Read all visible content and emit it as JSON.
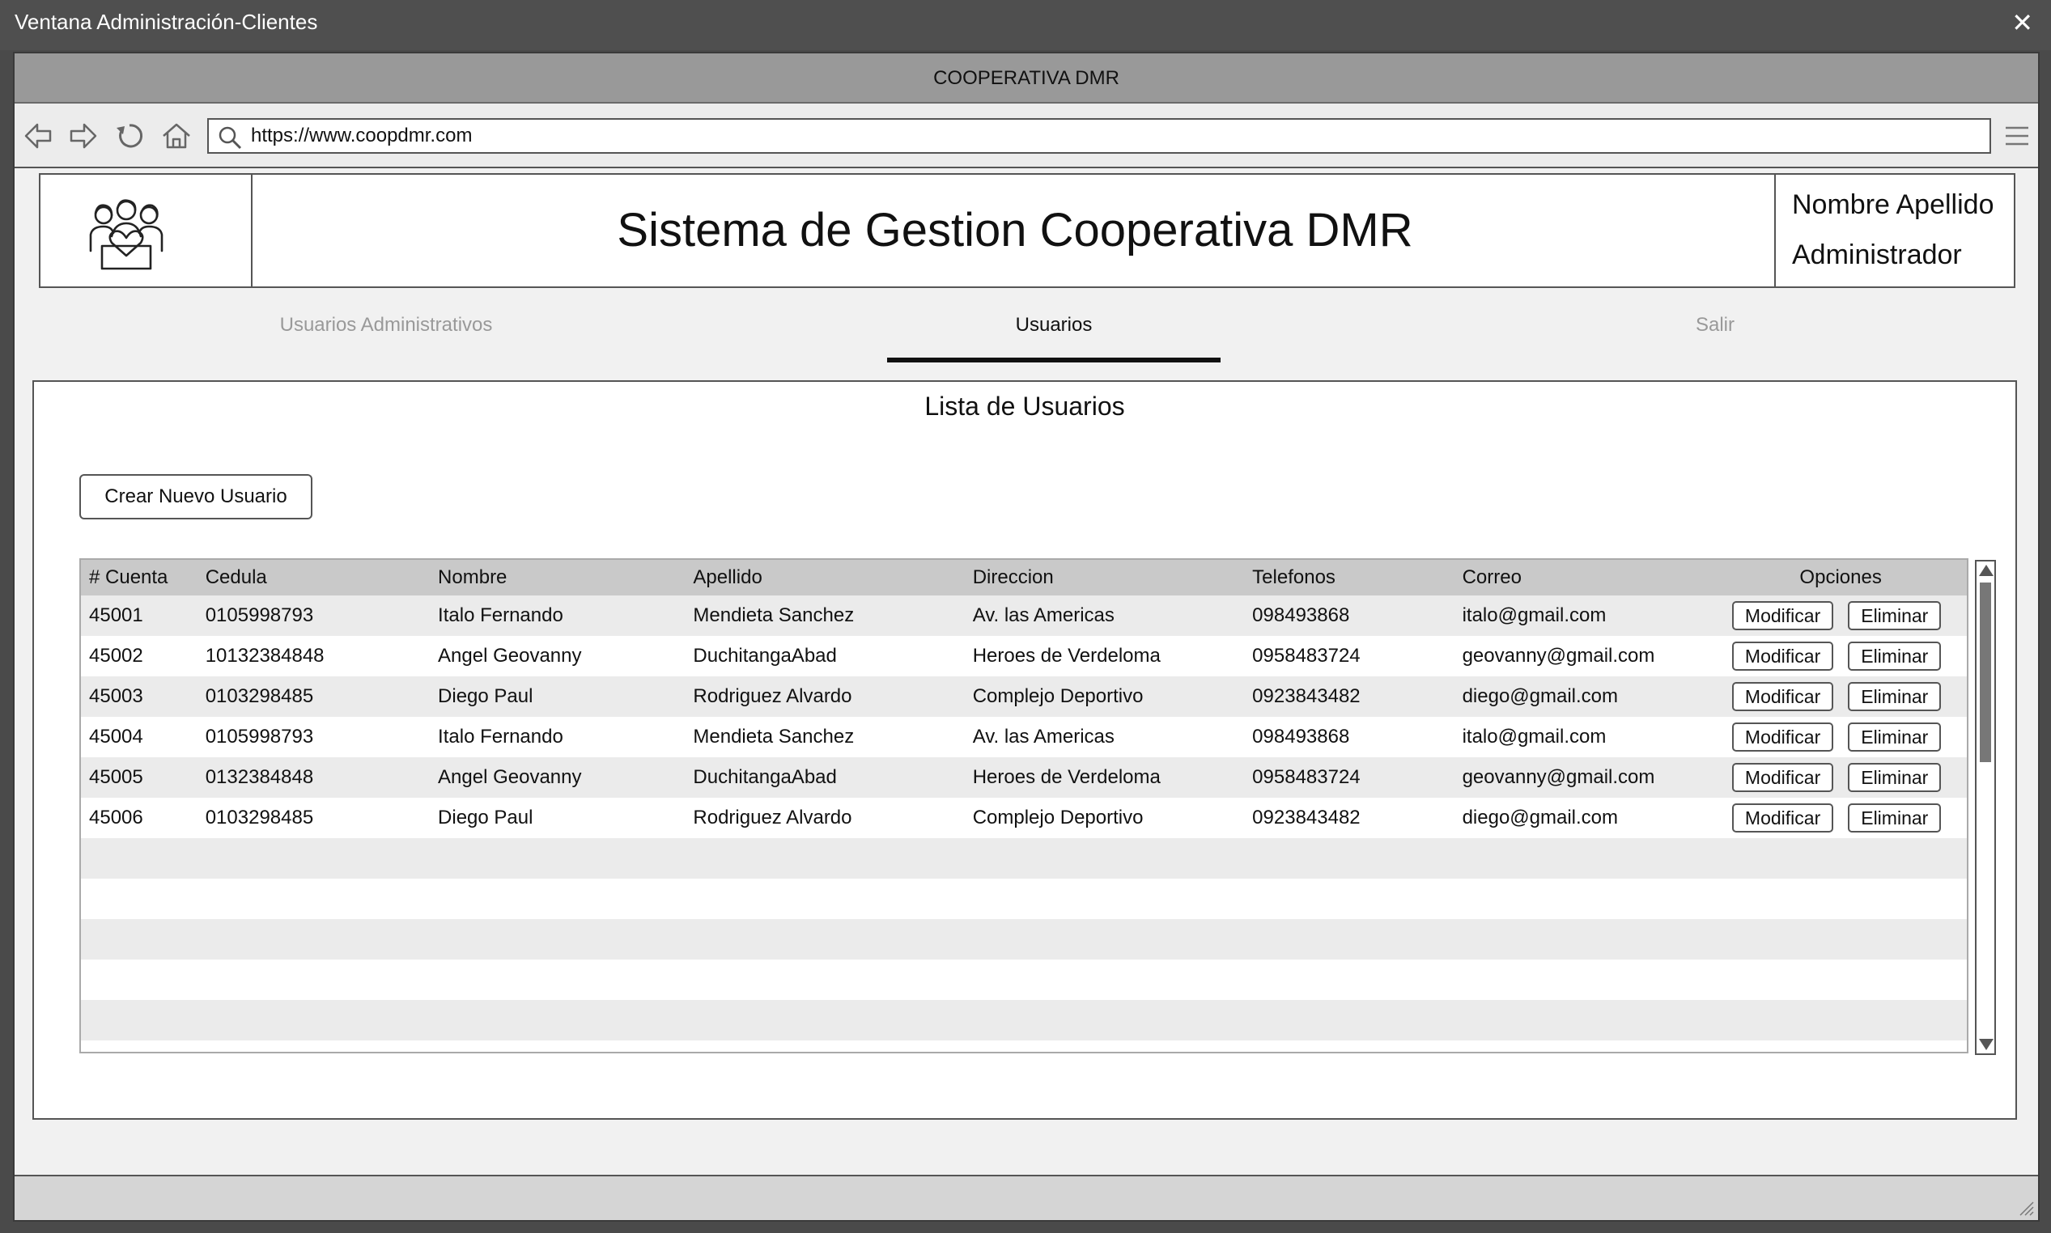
{
  "os_window": {
    "title": "Ventana Administración-Clientes",
    "close_glyph": "✕"
  },
  "browser": {
    "page_title": "COOPERATIVA DMR",
    "url": "https://www.coopdmr.com"
  },
  "header": {
    "title": "Sistema de Gestion Cooperativa DMR",
    "user_name": "Nombre Apellido",
    "user_role": "Administrador",
    "logo_icon": "family-heart-icon"
  },
  "tabs": [
    {
      "label": "Usuarios Administrativos",
      "active": false
    },
    {
      "label": "Usuarios",
      "active": true
    },
    {
      "label": "Salir",
      "active": false
    }
  ],
  "panel": {
    "title": "Lista de Usuarios",
    "create_button": "Crear Nuevo Usuario"
  },
  "table": {
    "columns": [
      "# Cuenta",
      "Cedula",
      "Nombre",
      "Apellido",
      "Direccion",
      "Telefonos",
      "Correo",
      "Opciones"
    ],
    "modify_label": "Modificar",
    "delete_label": "Eliminar",
    "rows": [
      [
        "45001",
        "0105998793",
        "Italo Fernando",
        "Mendieta Sanchez",
        "Av. las Americas",
        "098493868",
        "italo@gmail.com"
      ],
      [
        "45002",
        "10132384848",
        "Angel Geovanny",
        "DuchitangaAbad",
        "Heroes de Verdeloma",
        "0958483724",
        "geovanny@gmail.com"
      ],
      [
        "45003",
        "0103298485",
        "Diego Paul",
        "Rodriguez Alvardo",
        "Complejo Deportivo",
        "0923843482",
        "diego@gmail.com"
      ],
      [
        "45004",
        "0105998793",
        "Italo Fernando",
        "Mendieta Sanchez",
        "Av. las Americas",
        "098493868",
        "italo@gmail.com"
      ],
      [
        "45005",
        "0132384848",
        "Angel Geovanny",
        "DuchitangaAbad",
        "Heroes de Verdeloma",
        "0958483724",
        "geovanny@gmail.com"
      ],
      [
        "45006",
        "0103298485",
        "Diego Paul",
        "Rodriguez Alvardo",
        "Complejo Deportivo",
        "0923843482",
        "diego@gmail.com"
      ]
    ],
    "empty_rows": 5
  }
}
